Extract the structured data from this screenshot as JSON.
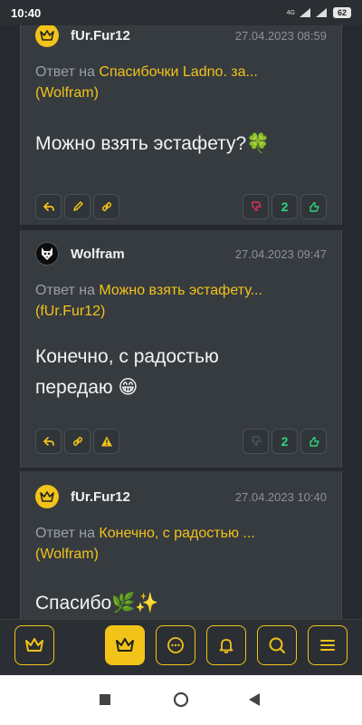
{
  "status_bar": {
    "time": "10:40",
    "network": "4G",
    "battery": "62"
  },
  "comments": [
    {
      "author": "fUr.Fur12",
      "avatar": "crown-icon",
      "date": "27.04.2023 08:59",
      "reply_prefix": "Ответ на",
      "reply_ref": "Спасибочки Ladno. за...",
      "reply_author": "(Wolfram)",
      "body": "Можно взять эстафету?🍀",
      "votes": "2"
    },
    {
      "author": "Wolfram",
      "avatar": "wolf-avatar",
      "date": "27.04.2023 09:47",
      "reply_prefix": "Ответ на",
      "reply_ref": "Можно взять эстафету...",
      "reply_author": "(fUr.Fur12)",
      "body": "Конечно, с радостью передаю 😁",
      "votes": "2"
    },
    {
      "author": "fUr.Fur12",
      "avatar": "crown-icon",
      "date": "27.04.2023 10:40",
      "reply_prefix": "Ответ на",
      "reply_ref": "Конечно, с радостью ...",
      "reply_author": "(Wolfram)",
      "body": "Спасибо🌿✨"
    }
  ],
  "colors": {
    "accent": "#f2c318",
    "upvote": "#2fd37c",
    "downvote": "#e0305a"
  }
}
